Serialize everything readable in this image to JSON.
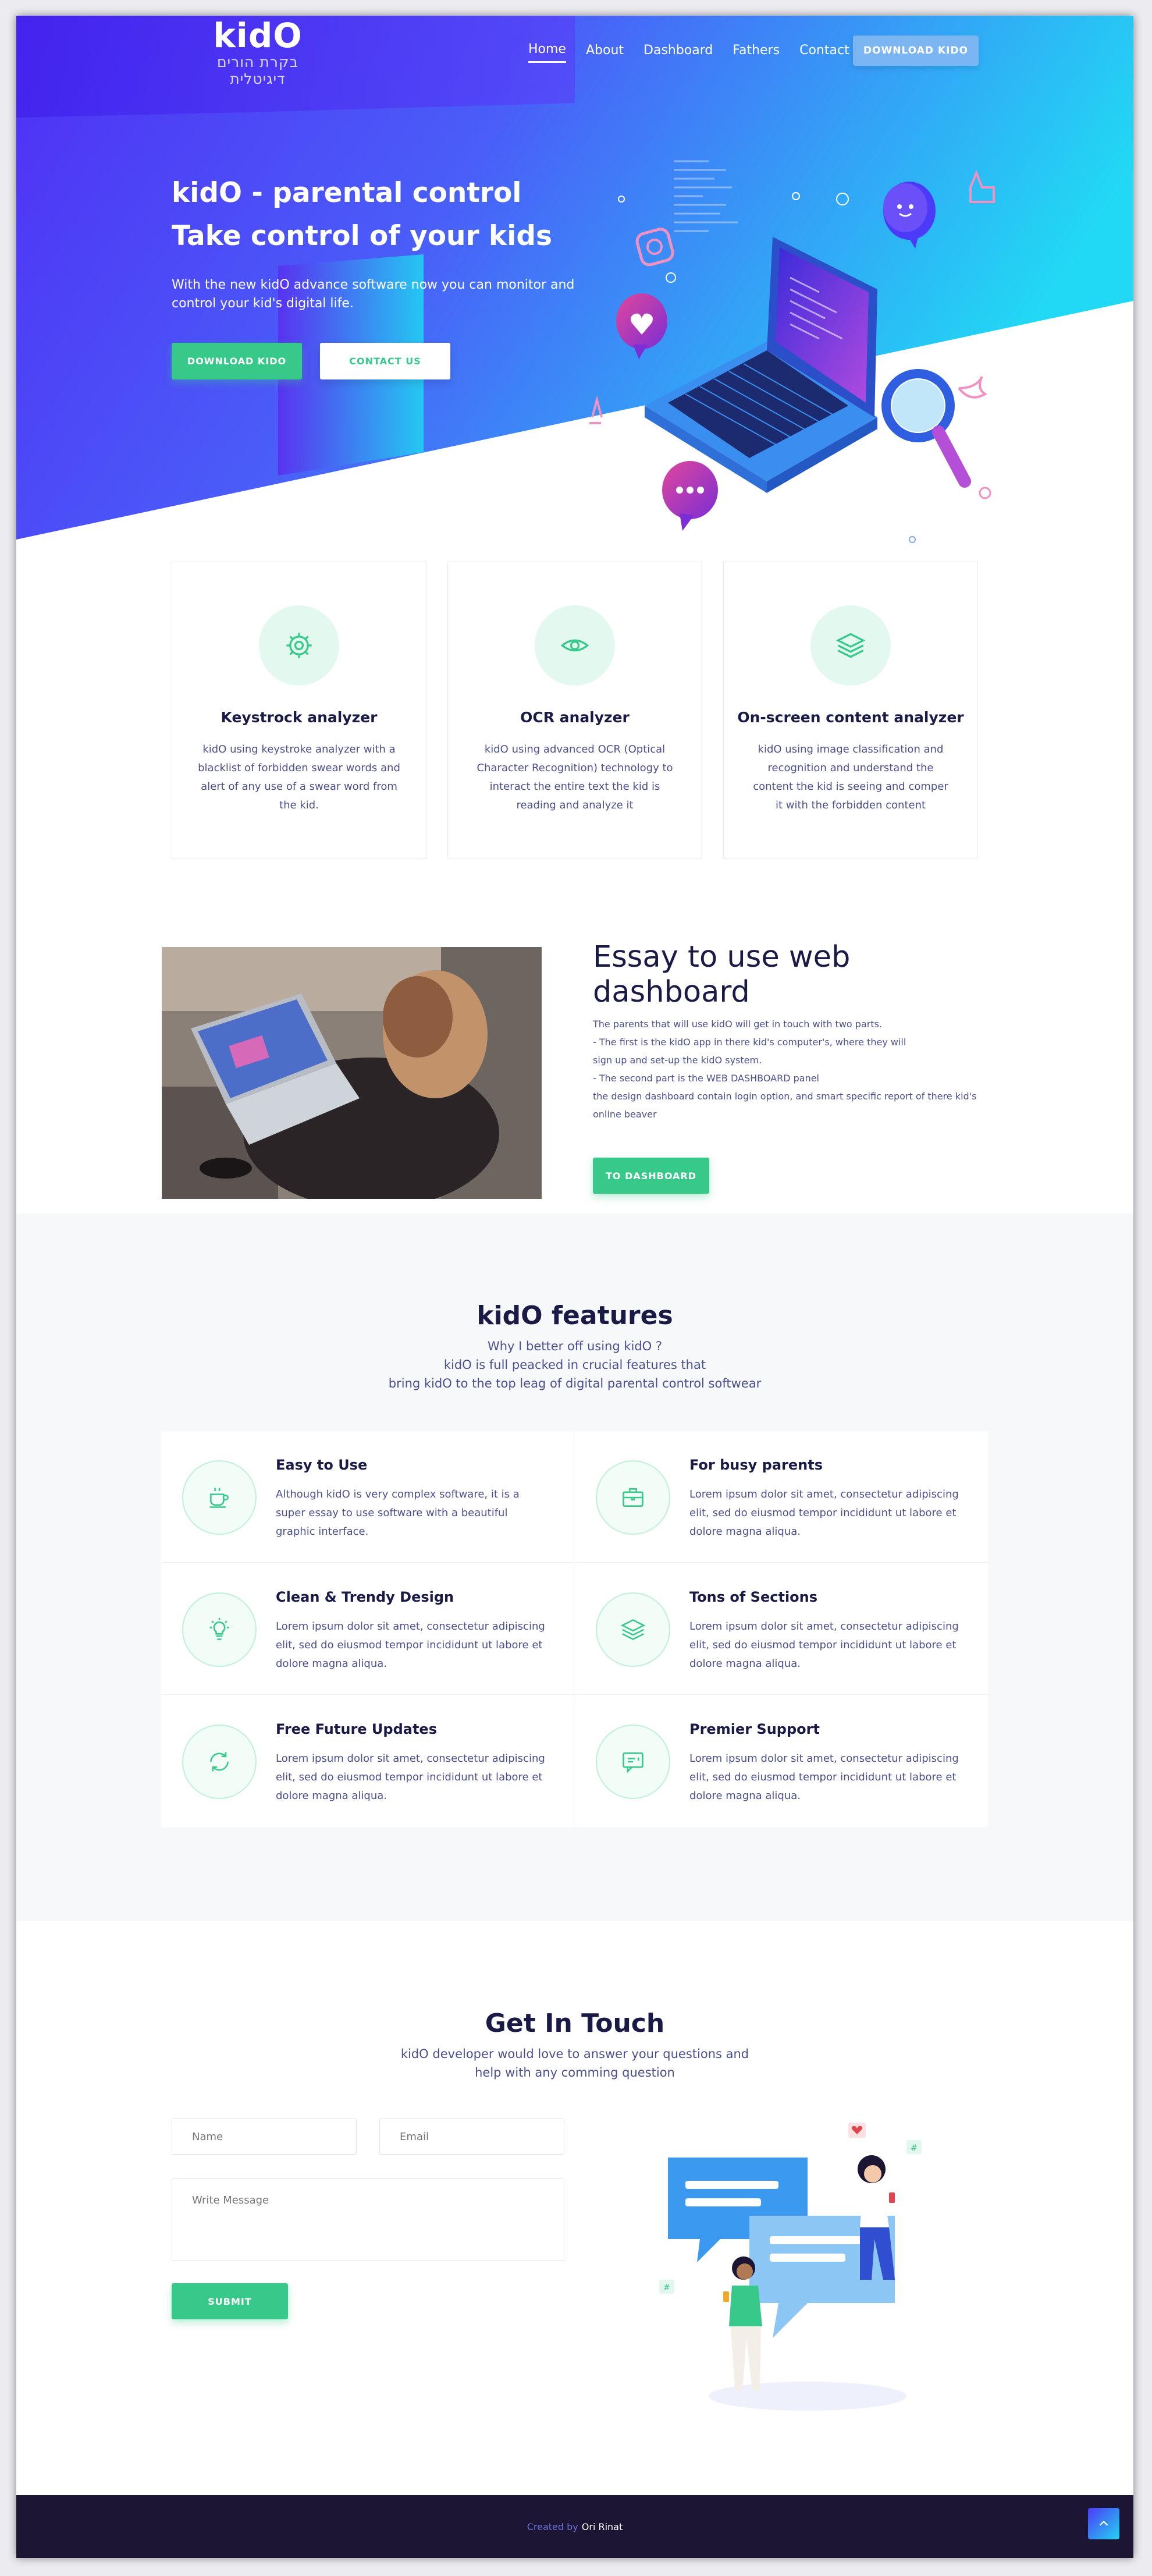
{
  "brand": {
    "name": "kidO",
    "subtitle": "בקרת הורים דיגיטלית"
  },
  "nav": {
    "links": [
      "Home",
      "About",
      "Dashboard",
      "Fathers",
      "Contact"
    ],
    "active": "Home",
    "download_btn": "DOWNLOAD KIDO"
  },
  "hero": {
    "title_line1": "kidO - parental control",
    "title_line2": "Take control of your kids",
    "text": "With the new kidO advance software now you can monitor and control your kid's digital life.",
    "primary_btn": "DOWNLOAD KIDO",
    "secondary_btn": "CONTACT US"
  },
  "cards": [
    {
      "icon": "gear-icon",
      "title": "Keystrock analyzer",
      "text": "kidO using keystroke analyzer with a blacklist of forbidden swear words and alert of any use of a swear word from the kid."
    },
    {
      "icon": "eye-icon",
      "title": "OCR analyzer",
      "text": "kidO using advanced OCR (Optical Character Recognition) technology to interact the entire text the kid is reading and analyze it"
    },
    {
      "icon": "layers-icon",
      "title": "On-screen content analyzer",
      "text": "kidO using image classification and recognition and understand the content the kid is seeing and comper it with the forbidden content"
    }
  ],
  "essay": {
    "title": "Essay to use web dashboard",
    "lines": [
      "The parents that will use kidO will get in touch with two parts.",
      "- The first is the kidO app in there kid's computer's, where they will",
      "sign up and set-up the kidO system.",
      "- The second part is the WEB DASHBOARD panel",
      "the design dashboard contain login option, and smart specific report of there kid's",
      "online beaver"
    ],
    "button": "TO DASHBOARD"
  },
  "features": {
    "title": "kidO features",
    "sub_lines": [
      "Why I better off using kidO ?",
      "kidO is full peacked in crucial features that",
      "bring kidO to the top leag of digital parental control softwear"
    ],
    "items": [
      {
        "icon": "cup-icon",
        "title": "Easy to Use",
        "text": "Although kidO is very complex software, it is a super essay to use software with a beautiful graphic interface."
      },
      {
        "icon": "briefcase-icon",
        "title": "For busy parents",
        "text": "Lorem ipsum dolor sit amet, consectetur adipiscing elit, sed do eiusmod tempor incididunt ut labore et dolore magna aliqua."
      },
      {
        "icon": "lightbulb-icon",
        "title": "Clean & Trendy Design",
        "text": "Lorem ipsum dolor sit amet, consectetur adipiscing elit, sed do eiusmod tempor incididunt ut labore et dolore magna aliqua."
      },
      {
        "icon": "layers-icon",
        "title": "Tons of Sections",
        "text": "Lorem ipsum dolor sit amet, consectetur adipiscing elit, sed do eiusmod tempor incididunt ut labore et dolore magna aliqua."
      },
      {
        "icon": "refresh-icon",
        "title": "Free Future Updates",
        "text": "Lorem ipsum dolor sit amet, consectetur adipiscing elit, sed do eiusmod tempor incididunt ut labore et dolore magna aliqua."
      },
      {
        "icon": "chat-icon",
        "title": "Premier Support",
        "text": "Lorem ipsum dolor sit amet, consectetur adipiscing elit, sed do eiusmod tempor incididunt ut labore et dolore magna aliqua."
      }
    ]
  },
  "contact": {
    "title": "Get In Touch",
    "sub_lines": [
      "kidO developer would love to answer your questions and",
      "help with any comming question"
    ],
    "name_placeholder": "Name",
    "email_placeholder": "Email",
    "message_placeholder": "Write Message",
    "submit": "SUBMIT"
  },
  "footer": {
    "prefix": "Created by",
    "author": "Ori Rinat"
  },
  "colors": {
    "primary": "#4b3af7",
    "accent": "#36c98a",
    "cyan": "#22d4f3",
    "dark": "#1a1a47",
    "footer": "#1c1533"
  }
}
